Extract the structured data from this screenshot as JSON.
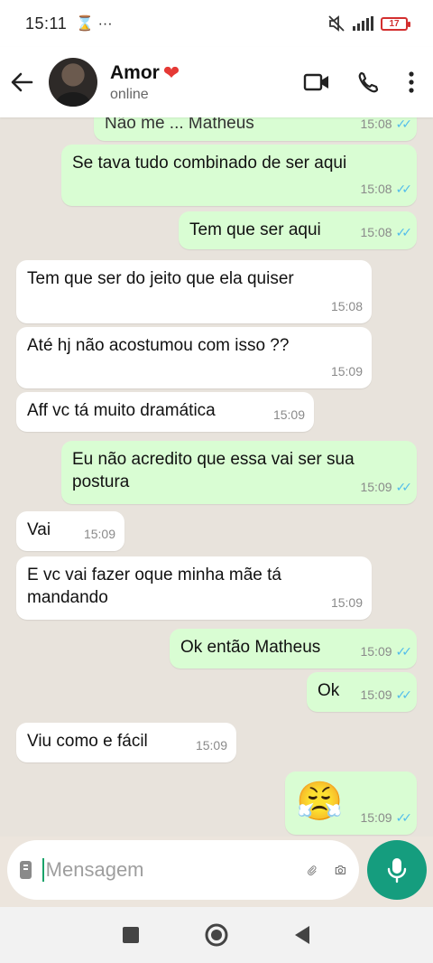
{
  "status_bar": {
    "time": "15:11",
    "extra": "⌛ ···",
    "battery": "17"
  },
  "header": {
    "name": "Amor",
    "heart": "❤",
    "status": "online"
  },
  "messages": [
    {
      "dir": "out",
      "text": "Não me ... Matheus",
      "time": "15:08",
      "ticks": "✓✓"
    },
    {
      "dir": "out",
      "text": "Se tava tudo combinado de ser aqui",
      "time": "15:08",
      "ticks": "✓✓"
    },
    {
      "dir": "out",
      "text": "Tem que ser aqui",
      "time": "15:08",
      "ticks": "✓✓"
    },
    {
      "dir": "in",
      "text": "Tem que ser do jeito que ela quiser",
      "time": "15:08"
    },
    {
      "dir": "in",
      "text": "Até hj não acostumou com isso ??",
      "time": "15:09"
    },
    {
      "dir": "in",
      "text": "Aff vc tá muito dramática",
      "time": "15:09"
    },
    {
      "dir": "out",
      "text": "Eu não acredito que essa vai ser sua postura",
      "time": "15:09",
      "ticks": "✓✓"
    },
    {
      "dir": "in",
      "text": "Vai",
      "time": "15:09"
    },
    {
      "dir": "in",
      "text": "E vc vai fazer oque minha mãe tá mandando",
      "time": "15:09"
    },
    {
      "dir": "out",
      "text": "Ok então Matheus",
      "time": "15:09",
      "ticks": "✓✓"
    },
    {
      "dir": "out",
      "text": "Ok",
      "time": "15:09",
      "ticks": "✓✓"
    },
    {
      "dir": "in",
      "text": "Viu como e fácil",
      "time": "15:09"
    },
    {
      "dir": "out",
      "text": "😤",
      "time": "15:09",
      "ticks": "✓✓"
    }
  ],
  "input": {
    "placeholder": "Mensagem"
  },
  "icons": {
    "back": "arrow-left-icon",
    "video": "video-call-icon",
    "call": "phone-icon",
    "menu": "more-vert-icon",
    "keyboard": "keyboard-icon",
    "attach": "paperclip-icon",
    "camera": "camera-icon",
    "mic": "mic-icon"
  },
  "colors": {
    "outgoing": "#d9fdd3",
    "incoming": "#ffffff",
    "accent": "#159d7e",
    "ticks": "#53bdeb"
  }
}
